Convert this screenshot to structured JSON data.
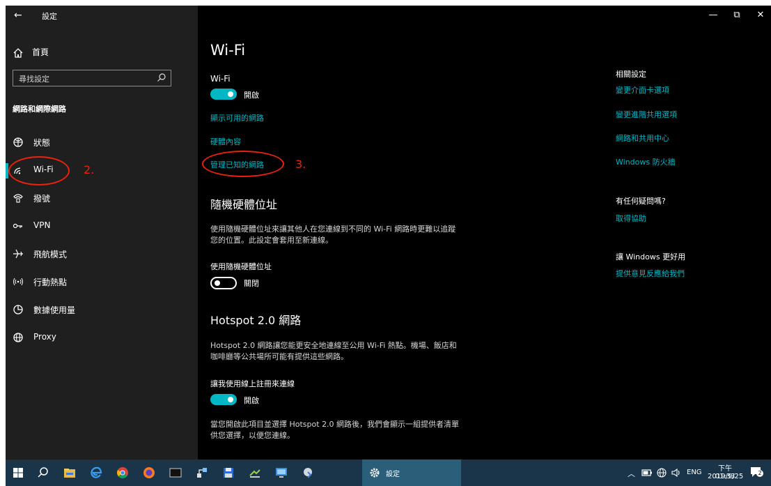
{
  "window": {
    "app_title": "設定",
    "back_icon": "back-arrow-icon",
    "minimize": "—",
    "restore": "⧉",
    "close": "✕"
  },
  "sidebar": {
    "home_label": "首頁",
    "search_placeholder": "尋找設定",
    "section_title": "網路和網際網路",
    "items": [
      {
        "label": "狀態",
        "icon": "globe-status-icon"
      },
      {
        "label": "Wi-Fi",
        "icon": "wifi-icon",
        "selected": true
      },
      {
        "label": "撥號",
        "icon": "dialup-icon"
      },
      {
        "label": "VPN",
        "icon": "vpn-icon"
      },
      {
        "label": "飛航模式",
        "icon": "airplane-icon"
      },
      {
        "label": "行動熱點",
        "icon": "hotspot-icon"
      },
      {
        "label": "數據使用量",
        "icon": "data-usage-icon"
      },
      {
        "label": "Proxy",
        "icon": "globe-icon"
      }
    ],
    "accent_color": "#00b7c3"
  },
  "annotations": {
    "label_2": "2.",
    "label_3": "3.",
    "color": "#e8220c"
  },
  "main": {
    "page_title": "Wi-Fi",
    "wifi_heading": "Wi-Fi",
    "wifi_toggle_state": "開啟",
    "link_show_networks": "顯示可用的網路",
    "link_hardware_props": "硬體內容",
    "link_manage_known": "管理已知的網路",
    "random_mac_heading": "隨機硬體位址",
    "random_mac_desc_line1": "使用隨機硬體位址來讓其他人在您連線到不同的 Wi-Fi 網路時更難以追蹤",
    "random_mac_desc_line2": "您的位置。此設定會套用至新連線。",
    "random_mac_label": "使用隨機硬體位址",
    "random_mac_state": "關閉",
    "hotspot_heading": "Hotspot 2.0 網路",
    "hotspot_desc_line1": "Hotspot 2.0 網路讓您能更安全地連線至公用 Wi-Fi 熱點。機場、飯店和",
    "hotspot_desc_line2": "咖啡廳等公共場所可能有提供這些網路。",
    "hotspot_signup_label": "讓我使用線上註冊來連線",
    "hotspot_signup_state": "開啟",
    "hotspot_note_line1": "當您開啟此項目並選擇 Hotspot 2.0 網路後，我們會顯示一組提供者清單",
    "hotspot_note_line2": "供您選擇，以便您連線。"
  },
  "related": {
    "heading": "相關設定",
    "links": [
      "變更介面卡選項",
      "變更進階共用選項",
      "網路和共用中心",
      "Windows 防火牆"
    ],
    "help_heading": "有任何疑問嗎?",
    "help_link": "取得協助",
    "better_heading": "讓 Windows 更好用",
    "feedback_link": "提供意見反應給我們"
  },
  "taskbar": {
    "settings_label": "設定",
    "ime": "ENG",
    "time": "下午 01:33",
    "date": "2019/9/25",
    "notification_count": "2"
  }
}
